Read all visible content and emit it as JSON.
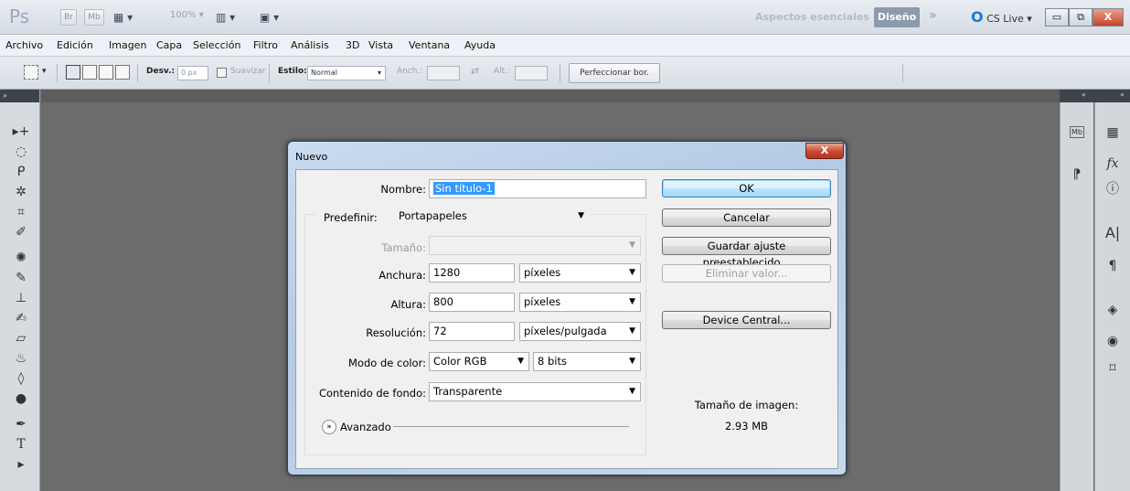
{
  "titlebar": {
    "logo": "Ps",
    "bridge": "Br",
    "minibridge": "Mb",
    "zoom": "100%",
    "workspaces": {
      "essentials": "Aspectos esenciales",
      "active": "Diseño"
    },
    "more": "»",
    "cslive": "CS Live",
    "win_min": "▭",
    "win_max": "⧉",
    "win_close": "X"
  },
  "menu": [
    "Archivo",
    "Edición",
    "Imagen",
    "Capa",
    "Selección",
    "Filtro",
    "Análisis",
    "3D",
    "Vista",
    "Ventana",
    "Ayuda"
  ],
  "options": {
    "feather_label": "Desv.:",
    "feather_value": "0 px",
    "antialias_label": "Suavizar",
    "style_label": "Estilo:",
    "style_value": "Normal",
    "width_label": "Anch.:",
    "height_label": "Alt.:",
    "refine_button": "Perfeccionar bor."
  },
  "panels": {
    "collapse_left": "»",
    "collapse_right": "«",
    "minibridge": "Mb"
  },
  "dialog": {
    "title": "Nuevo",
    "close": "X",
    "name_label": "Nombre:",
    "name_value": "Sin título-1",
    "preset_label": "Predefinir:",
    "preset_value": "Portapapeles",
    "size_label": "Tamaño:",
    "width_label": "Anchura:",
    "width_value": "1280",
    "width_unit": "píxeles",
    "height_label": "Altura:",
    "height_value": "800",
    "height_unit": "píxeles",
    "resolution_label": "Resolución:",
    "resolution_value": "72",
    "resolution_unit": "píxeles/pulgada",
    "color_mode_label": "Modo de color:",
    "color_mode_value": "Color RGB",
    "bit_depth": "8 bits",
    "background_label": "Contenido de fondo:",
    "background_value": "Transparente",
    "advanced": "Avanzado",
    "ok": "OK",
    "cancel": "Cancelar",
    "save_preset": "Guardar ajuste preestablecido...",
    "delete_preset": "Eliminar valor...",
    "device_central": "Device Central...",
    "image_size_label": "Tamaño de imagen:",
    "image_size_value": "2.93 MB"
  }
}
